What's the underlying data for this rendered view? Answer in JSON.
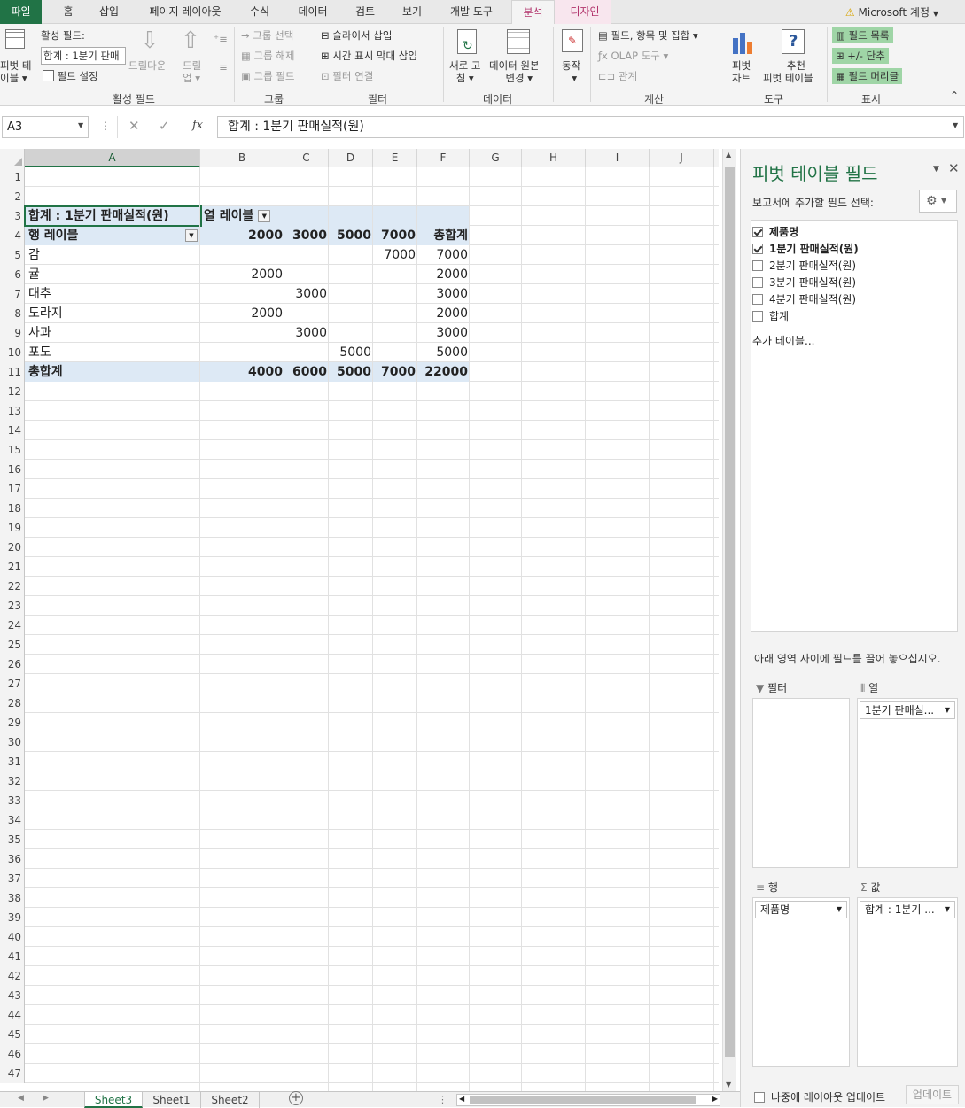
{
  "ribbon_tabs": [
    "파일",
    "홈",
    "삽입",
    "페이지 레이아웃",
    "수식",
    "데이터",
    "검토",
    "보기",
    "개발 도구",
    "분석",
    "디자인"
  ],
  "account": "Microsoft 계정",
  "ribbon": {
    "pivot_table_top": "피벗 테",
    "pivot_table_bottom": "이블",
    "active_field_label": "활성 필드:",
    "active_field_value": "합계 : 1분기 판매",
    "field_settings": "필드 설정",
    "drill_down": "드릴다운",
    "drill_up_top": "드릴",
    "drill_up_bottom": "업",
    "group_active_field": "활성 필드",
    "group_selection": "그룹 선택",
    "ungroup": "그룹 해제",
    "group_field": "그룹 필드",
    "group_group": "그룹",
    "insert_slicer": "슬라이서 삽입",
    "insert_timeline": "시간 표시 막대 삽입",
    "filter_connections": "필터 연결",
    "group_filter": "필터",
    "refresh_top": "새로 고",
    "refresh_bottom": "침",
    "change_source_top": "데이터 원본",
    "change_source_bottom": "변경",
    "group_data": "데이터",
    "actions": "동작",
    "fields_items_sets": "필드, 항목 및 집합",
    "olap_tools": "OLAP 도구",
    "relationships": "관계",
    "group_calc": "계산",
    "pivot_chart_top": "피벗",
    "pivot_chart_bottom": "차트",
    "recommended_top": "추천",
    "recommended_bottom": "피벗 테이블",
    "group_tools": "도구",
    "field_list": "필드 목록",
    "buttons": "+/- 단추",
    "field_headers": "필드 머리글",
    "group_show": "표시"
  },
  "name_box": "A3",
  "formula": "합계 : 1분기 판매실적(원)",
  "columns": [
    "A",
    "B",
    "C",
    "D",
    "E",
    "F",
    "G",
    "H",
    "I",
    "J"
  ],
  "row_numbers": [
    "1",
    "2",
    "3",
    "4",
    "5",
    "6",
    "7",
    "8",
    "9",
    "10",
    "11",
    "12",
    "13",
    "14",
    "15",
    "16",
    "17",
    "18",
    "19",
    "20",
    "21",
    "22",
    "23",
    "24",
    "25",
    "26",
    "27",
    "28",
    "29",
    "30",
    "31",
    "32",
    "33",
    "34",
    "35",
    "36",
    "37",
    "38",
    "39",
    "40",
    "41",
    "42",
    "43",
    "44",
    "45",
    "46",
    "47"
  ],
  "pivot": {
    "value_header": "합계 : 1분기 판매실적(원)",
    "col_labels_header": "열 레이블",
    "row_labels_header": "행 레이블",
    "col_headers": [
      "2000",
      "3000",
      "5000",
      "7000",
      "총합계"
    ],
    "rows": [
      {
        "label": "감",
        "cells": [
          "",
          "",
          "",
          "7000",
          "7000"
        ]
      },
      {
        "label": "귤",
        "cells": [
          "2000",
          "",
          "",
          "",
          "2000"
        ]
      },
      {
        "label": "대추",
        "cells": [
          "",
          "3000",
          "",
          "",
          "3000"
        ]
      },
      {
        "label": "도라지",
        "cells": [
          "2000",
          "",
          "",
          "",
          "2000"
        ]
      },
      {
        "label": "사과",
        "cells": [
          "",
          "3000",
          "",
          "",
          "3000"
        ]
      },
      {
        "label": "포도",
        "cells": [
          "",
          "",
          "5000",
          "",
          "5000"
        ]
      }
    ],
    "total": {
      "label": "총합계",
      "cells": [
        "4000",
        "6000",
        "5000",
        "7000",
        "22000"
      ]
    }
  },
  "sheets": [
    "Sheet3",
    "Sheet1",
    "Sheet2"
  ],
  "pane": {
    "title": "피벗 테이블 필드",
    "choose_fields": "보고서에 추가할 필드 선택:",
    "fields": [
      {
        "label": "제품명",
        "checked": true
      },
      {
        "label": "1분기 판매실적(원)",
        "checked": true
      },
      {
        "label": "2분기 판매실적(원)",
        "checked": false
      },
      {
        "label": "3분기 판매실적(원)",
        "checked": false
      },
      {
        "label": "4분기 판매실적(원)",
        "checked": false
      },
      {
        "label": "합계",
        "checked": false
      }
    ],
    "more_tables": "추가 테이블...",
    "drag_hint": "아래 영역 사이에 필드를 끌어 놓으십시오.",
    "filters_label": "필터",
    "columns_label": "열",
    "rows_label": "행",
    "values_label": "값",
    "columns_chip": "1분기 판매실...",
    "rows_chip": "제품명",
    "values_chip": "합계 : 1분기 ...",
    "defer_update": "나중에 레이아웃 업데이트",
    "update_button": "업데이트"
  }
}
